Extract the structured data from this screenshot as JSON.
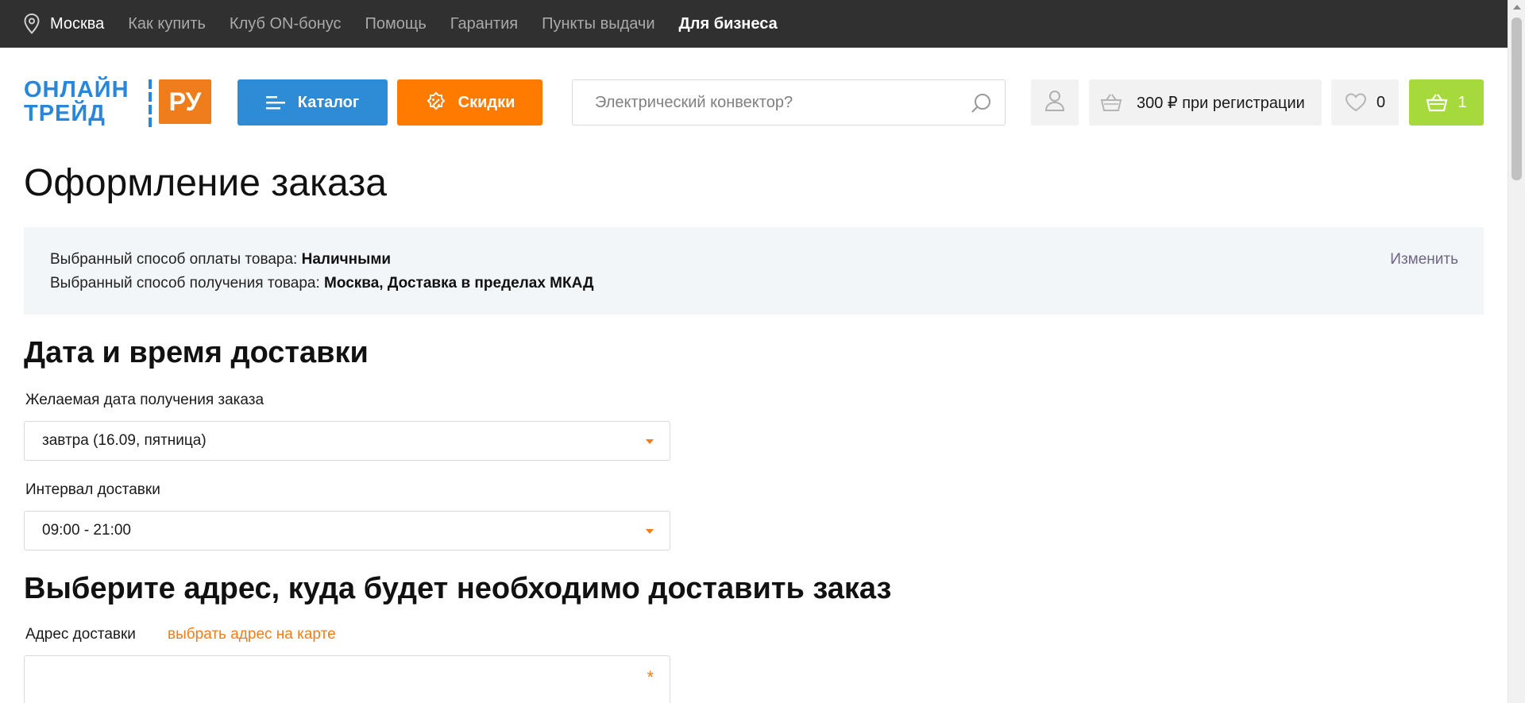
{
  "topbar": {
    "city": "Москва",
    "links": [
      "Как купить",
      "Клуб ON-бонус",
      "Помощь",
      "Гарантия",
      "Пункты выдачи"
    ],
    "business_link": "Для бизнеса"
  },
  "header": {
    "logo_line1": "ОНЛАЙН",
    "logo_line2": "ТРЕЙД",
    "logo_ru": "РУ",
    "catalog_label": "Каталог",
    "discount_label": "Скидки",
    "search_placeholder": "Электрический конвектор?",
    "bonus_label": "300 ₽ при регистрации",
    "favorites_count": "0",
    "cart_count": "1"
  },
  "main": {
    "page_title": "Оформление заказа",
    "payment_prefix": "Выбранный способ оплаты товара: ",
    "payment_value": "Наличными",
    "delivery_prefix": "Выбранный способ получения товара: ",
    "delivery_value": "Москва, Доставка в пределах МКАД",
    "change_link": "Изменить",
    "delivery_section_title": "Дата и время доставки",
    "date_label": "Желаемая дата получения заказа",
    "date_value": "завтра (16.09, пятница)",
    "interval_label": "Интервал доставки",
    "interval_value": "09:00 - 21:00",
    "address_section_title": "Выберите адрес, куда будет необходимо доставить заказ",
    "address_label": "Адрес доставки",
    "map_link": "выбрать адрес на карте",
    "required_mark": "*"
  },
  "colors": {
    "topbar_bg": "#303030",
    "catalog_btn": "#2e8bd6",
    "discount_btn": "#ff7b00",
    "cart_btn": "#a6d93b",
    "accent_orange": "#f07d1c",
    "info_bg": "#f2f6f9"
  },
  "icons": {
    "topbar": "location-pin-icon",
    "catalog": "menu-lines-icon",
    "discount": "percent-badge-icon",
    "search": "search-icon",
    "user": "user-icon",
    "bonus": "basket-icon",
    "favorites": "heart-icon",
    "cart": "cart-basket-icon"
  }
}
